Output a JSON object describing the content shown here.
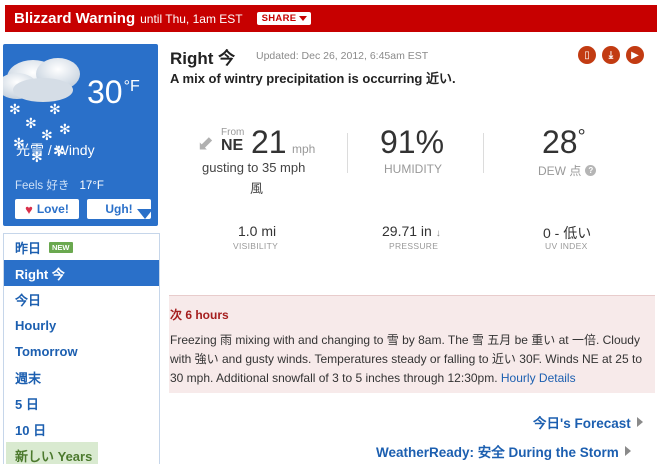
{
  "alert": {
    "title": "Blizzard Warning",
    "until": "until Thu, 1am EST",
    "share_label": "SHARE"
  },
  "tile": {
    "temperature": "30",
    "unit": "°F",
    "condition": "光雪 / Windy",
    "feels_label": "Feels 好き",
    "feels_value": "17°F",
    "love_label": "Love!",
    "ugh_label": "Ugh!",
    "color": "#2a70c9"
  },
  "nav": {
    "items": [
      {
        "label": "昨日",
        "badge": "NEW"
      },
      {
        "label": "Right 今"
      },
      {
        "label": "今日"
      },
      {
        "label": "Hourly"
      },
      {
        "label": "Tomorrow"
      },
      {
        "label": "週末"
      },
      {
        "label": "5 日"
      },
      {
        "label": "10 日"
      },
      {
        "label": "新しい Years"
      }
    ],
    "active_index": 1
  },
  "header": {
    "location": "Right 今",
    "updated": "Updated: Dec 26, 2012, 6:45am EST",
    "summary": "A mix of wintry precipitation is occurring 近い."
  },
  "conditions": {
    "wind": {
      "from_label": "From",
      "direction": "NE",
      "speed": "21",
      "unit": "mph",
      "gusts": "gusting to 35 mph",
      "word": "風"
    },
    "humidity": {
      "value": "91%",
      "label": "HUMIDITY"
    },
    "dew": {
      "value": "28",
      "deg": "°",
      "label": "DEW 点"
    },
    "visibility": {
      "value": "1.0 mi",
      "label": "VISIBILITY"
    },
    "pressure": {
      "value": "29.71 in",
      "label": "PRESSURE"
    },
    "uv": {
      "value": "0 - 低い",
      "label": "UV INDEX"
    }
  },
  "next": {
    "title": "次 6 hours",
    "text": "Freezing 雨 mixing with and changing to 雪 by 8am. The 雪 五月 be 重い at 一倍. Cloudy with 強い and gusty winds. Temperatures steady or falling to 近い 30F. Winds NE at 25 to 30 mph. Additional snowfall of 3 to 5 inches through 12:30pm.",
    "link": "Hourly Details"
  },
  "links": {
    "forecast": "今日's Forecast",
    "weatherready": "WeatherReady: 安全 During the Storm"
  },
  "icons": [
    "mobile-icon",
    "download-icon",
    "video-icon",
    "wind-arrow-icon",
    "help-icon",
    "snow-cloud-icon"
  ]
}
